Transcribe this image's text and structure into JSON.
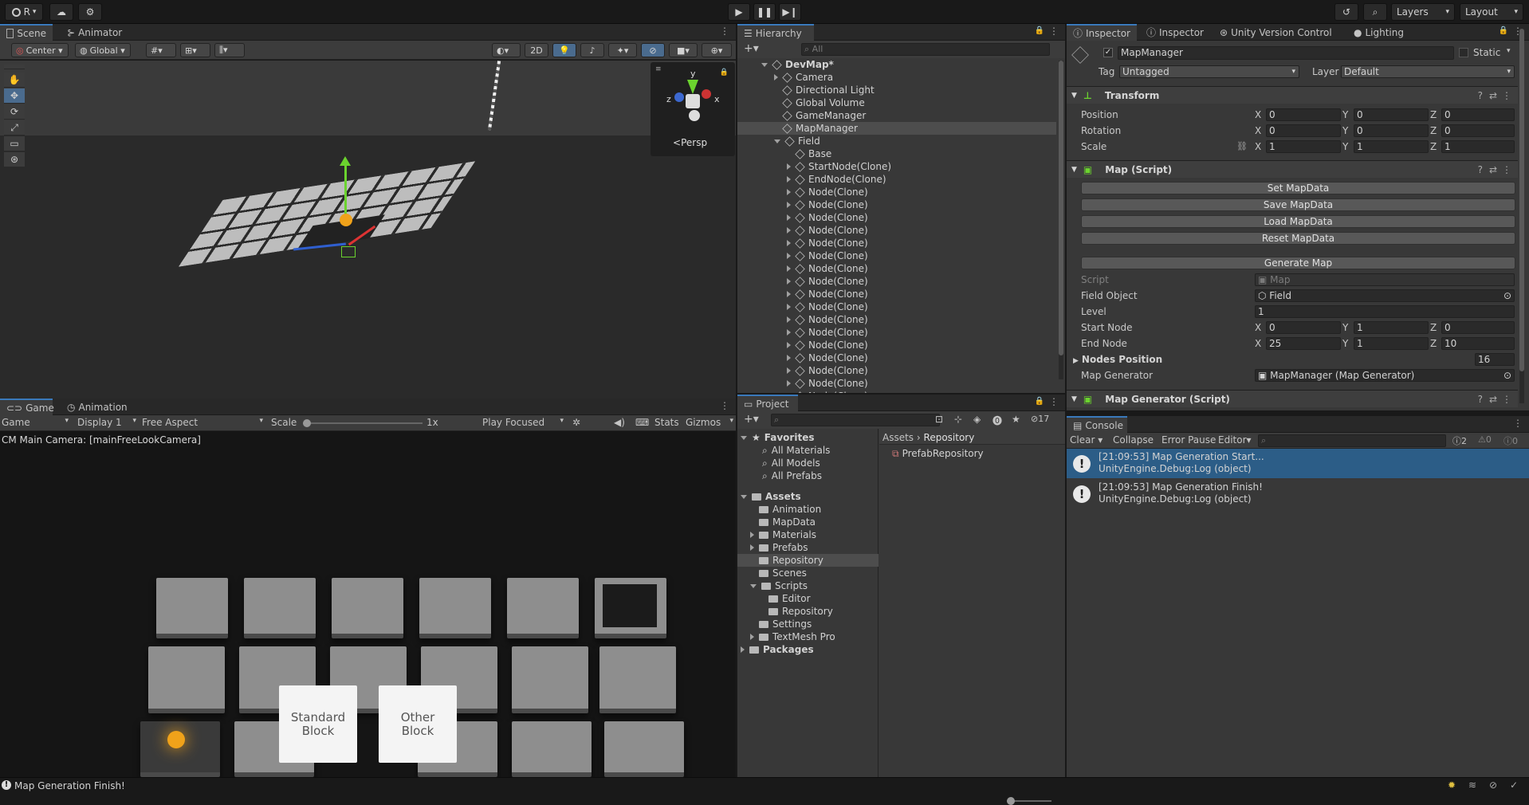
{
  "topbar": {
    "account": "R",
    "layers": "Layers",
    "layout": "Layout"
  },
  "scene": {
    "tabs": [
      "Scene",
      "Animator"
    ],
    "pivot": "Center",
    "space": "Global",
    "mode_2d": "2D",
    "persp": "Persp",
    "gizmo_axes": [
      "y",
      "z",
      "x"
    ]
  },
  "game": {
    "tabs": [
      "Game",
      "Animation"
    ],
    "mode": "Game",
    "display": "Display 1",
    "aspect": "Free Aspect",
    "scale_label": "Scale",
    "scale_value": "1x",
    "play_mode": "Play Focused",
    "stats": "Stats",
    "gizmos": "Gizmos",
    "camera_label": "CM Main Camera: [mainFreeLookCamera]",
    "buttons": [
      "Standard\nBlock",
      "Other\nBlock"
    ]
  },
  "hierarchy": {
    "title": "Hierarchy",
    "search": "All",
    "rows": [
      {
        "label": "DevMap*",
        "depth": 0,
        "bold": true,
        "expanded": true,
        "icon": "unity-scene-icon"
      },
      {
        "label": "Camera",
        "depth": 1,
        "arrow": true
      },
      {
        "label": "Directional Light",
        "depth": 1
      },
      {
        "label": "Global Volume",
        "depth": 1
      },
      {
        "label": "GameManager",
        "depth": 1
      },
      {
        "label": "MapManager",
        "depth": 1,
        "selected": true
      },
      {
        "label": "Field",
        "depth": 1,
        "expanded": true
      },
      {
        "label": "Base",
        "depth": 2
      },
      {
        "label": "StartNode(Clone)",
        "depth": 2,
        "arrow": true
      },
      {
        "label": "EndNode(Clone)",
        "depth": 2,
        "arrow": true
      },
      {
        "label": "Node(Clone)",
        "depth": 2,
        "arrow": true
      },
      {
        "label": "Node(Clone)",
        "depth": 2,
        "arrow": true
      },
      {
        "label": "Node(Clone)",
        "depth": 2,
        "arrow": true
      },
      {
        "label": "Node(Clone)",
        "depth": 2,
        "arrow": true
      },
      {
        "label": "Node(Clone)",
        "depth": 2,
        "arrow": true
      },
      {
        "label": "Node(Clone)",
        "depth": 2,
        "arrow": true
      },
      {
        "label": "Node(Clone)",
        "depth": 2,
        "arrow": true
      },
      {
        "label": "Node(Clone)",
        "depth": 2,
        "arrow": true
      },
      {
        "label": "Node(Clone)",
        "depth": 2,
        "arrow": true
      },
      {
        "label": "Node(Clone)",
        "depth": 2,
        "arrow": true
      },
      {
        "label": "Node(Clone)",
        "depth": 2,
        "arrow": true
      },
      {
        "label": "Node(Clone)",
        "depth": 2,
        "arrow": true
      },
      {
        "label": "Node(Clone)",
        "depth": 2,
        "arrow": true
      },
      {
        "label": "Node(Clone)",
        "depth": 2,
        "arrow": true
      },
      {
        "label": "Node(Clone)",
        "depth": 2,
        "arrow": true
      },
      {
        "label": "Node(Clone)",
        "depth": 2,
        "arrow": true
      },
      {
        "label": "Node(Clone)",
        "depth": 2,
        "arrow": true
      }
    ]
  },
  "inspector": {
    "tabs": [
      "Inspector",
      "Inspector",
      "Unity Version Control",
      "Lighting"
    ],
    "object_name": "MapManager",
    "static": "Static",
    "tag_label": "Tag",
    "tag": "Untagged",
    "layer_label": "Layer",
    "layer": "Default",
    "transform": {
      "title": "Transform",
      "rows": [
        {
          "label": "Position",
          "x": "0",
          "y": "0",
          "z": "0"
        },
        {
          "label": "Rotation",
          "x": "0",
          "y": "0",
          "z": "0"
        },
        {
          "label": "Scale",
          "x": "1",
          "y": "1",
          "z": "1"
        }
      ]
    },
    "map_script": {
      "title": "Map (Script)",
      "buttons": [
        "Set MapData",
        "Save MapData",
        "Load MapData",
        "Reset MapData"
      ],
      "generate": "Generate Map",
      "script_label": "Script",
      "script_value": "Map",
      "field_label": "Field Object",
      "field_value": "Field",
      "level_label": "Level",
      "level_value": "1",
      "start_label": "Start Node",
      "start": {
        "x": "0",
        "y": "1",
        "z": "0"
      },
      "end_label": "End Node",
      "end": {
        "x": "25",
        "y": "1",
        "z": "10"
      },
      "nodes_label": "Nodes Position",
      "nodes_count": "16",
      "generator_label": "Map Generator",
      "generator_value": "MapManager (Map Generator)"
    },
    "map_generator": {
      "title": "Map Generator (Script)"
    }
  },
  "project": {
    "title": "Project",
    "hidden_count": "17",
    "breadcrumb": [
      "Assets",
      "Repository"
    ],
    "favorites": [
      "All Materials",
      "All Models",
      "All Prefabs"
    ],
    "favorites_label": "Favorites",
    "assets_label": "Assets",
    "assets": [
      {
        "label": "Animation",
        "depth": 1
      },
      {
        "label": "MapData",
        "depth": 1
      },
      {
        "label": "Materials",
        "depth": 1,
        "arrow": true
      },
      {
        "label": "Prefabs",
        "depth": 1,
        "arrow": true
      },
      {
        "label": "Repository",
        "depth": 1,
        "selected": true
      },
      {
        "label": "Scenes",
        "depth": 1
      },
      {
        "label": "Scripts",
        "depth": 1,
        "expanded": true
      },
      {
        "label": "Editor",
        "depth": 2
      },
      {
        "label": "Repository",
        "depth": 2
      },
      {
        "label": "Settings",
        "depth": 1
      },
      {
        "label": "TextMesh Pro",
        "depth": 1,
        "arrow": true
      }
    ],
    "packages_label": "Packages",
    "file": "PrefabRepository"
  },
  "console": {
    "title": "Console",
    "clear": "Clear",
    "collapse": "Collapse",
    "error_pause": "Error Pause",
    "editor": "Editor",
    "counts": {
      "log": "2",
      "warn": "0",
      "error": "0"
    },
    "entries": [
      {
        "line1": "[21:09:53] Map Generation Start...",
        "line2": "UnityEngine.Debug:Log (object)",
        "selected": true
      },
      {
        "line1": "[21:09:53] Map Generation Finish!",
        "line2": "UnityEngine.Debug:Log (object)",
        "selected": false
      }
    ]
  },
  "status": {
    "message": "Map Generation Finish!"
  },
  "colors": {
    "accent": "#3a79bb",
    "selection": "#2c5d87",
    "panel": "#383838"
  }
}
